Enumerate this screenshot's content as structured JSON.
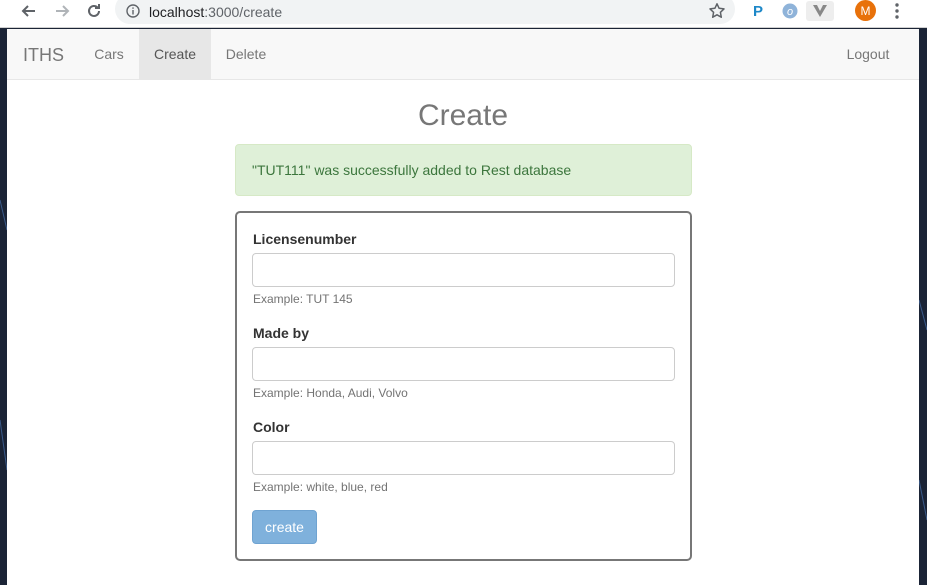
{
  "browser": {
    "url_host": "localhost",
    "url_path": ":3000/create",
    "avatar_letter": "M",
    "extensions": [
      "P",
      "o",
      "V"
    ]
  },
  "navbar": {
    "brand": "ITHS",
    "items": [
      {
        "label": "Cars",
        "active": false
      },
      {
        "label": "Create",
        "active": true
      },
      {
        "label": "Delete",
        "active": false
      }
    ],
    "logout": "Logout"
  },
  "main": {
    "title": "Create",
    "alert": "\"TUT111\" was successfully added to Rest database"
  },
  "form": {
    "fields": [
      {
        "label": "Licensenumber",
        "value": "",
        "help": "Example: TUT 145"
      },
      {
        "label": "Made by",
        "value": "",
        "help": "Example: Honda, Audi, Volvo"
      },
      {
        "label": "Color",
        "value": "",
        "help": "Example: white, blue, red"
      }
    ],
    "submit_label": "create"
  },
  "colors": {
    "alert_bg": "#dff0d8",
    "alert_text": "#3c763d",
    "submit_bg": "#7fb1dc",
    "avatar_bg": "#e8710a"
  }
}
